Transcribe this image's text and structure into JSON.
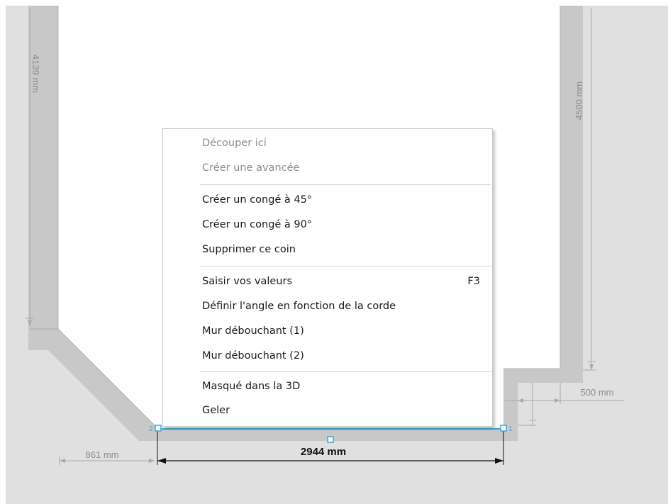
{
  "drawing": {
    "dimensions": {
      "left_wall_height": "4139 mm",
      "right_wall_height": "4500 mm",
      "bottom_offset_left": "861 mm",
      "selected_wall_length": "2944 mm",
      "right_offset": "500 mm"
    },
    "node_labels": {
      "start": "2",
      "end": "1"
    },
    "colors": {
      "background": "#ffffff",
      "floor": "#e0e0e0",
      "wall": "#c8c8c8",
      "wall_dark": "#b3b3b3",
      "selection": "#39a7d9",
      "dimension_secondary": "#a8a8a8",
      "dimension_primary": "#111111"
    }
  },
  "context_menu": {
    "items": [
      {
        "label": "Découper ici",
        "disabled": true,
        "shortcut": ""
      },
      {
        "label": "Créer une avancée",
        "disabled": true,
        "shortcut": ""
      },
      {
        "label": "Créer un congé à 45°",
        "disabled": false,
        "shortcut": ""
      },
      {
        "label": "Créer un congé à 90°",
        "disabled": false,
        "shortcut": ""
      },
      {
        "label": "Supprimer ce coin",
        "disabled": false,
        "shortcut": ""
      },
      {
        "label": "Saisir vos valeurs",
        "disabled": false,
        "shortcut": "F3"
      },
      {
        "label": "Définir l'angle en fonction de la corde",
        "disabled": false,
        "shortcut": ""
      },
      {
        "label": "Mur débouchant (1)",
        "disabled": false,
        "shortcut": ""
      },
      {
        "label": "Mur débouchant (2)",
        "disabled": false,
        "shortcut": ""
      },
      {
        "label": "Masqué dans la 3D",
        "disabled": false,
        "shortcut": ""
      },
      {
        "label": "Geler",
        "disabled": false,
        "shortcut": ""
      }
    ]
  }
}
